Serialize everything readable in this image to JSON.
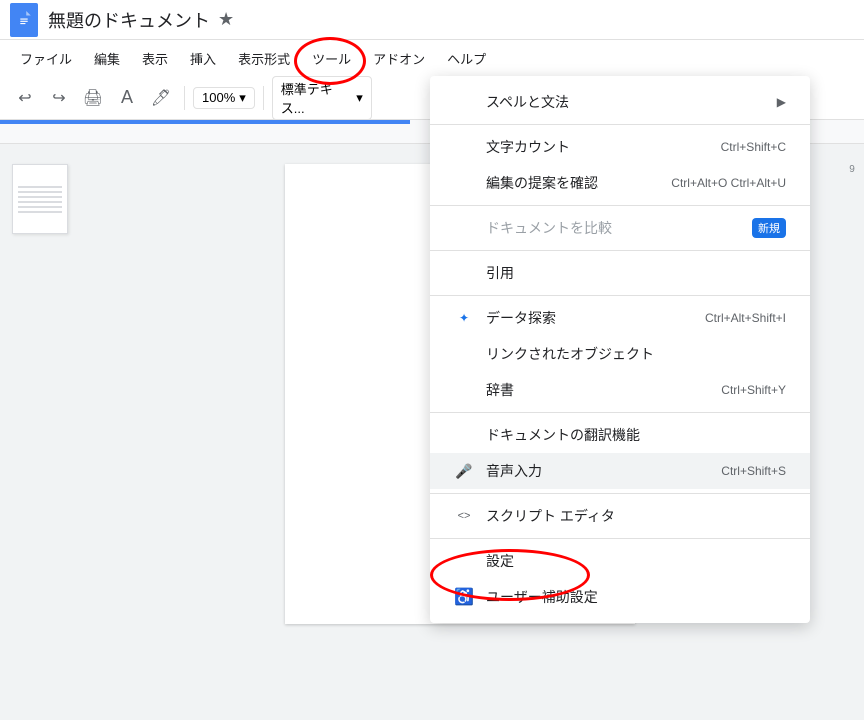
{
  "titleBar": {
    "docTitle": "無題のドキュメント",
    "starLabel": "★"
  },
  "menuBar": {
    "items": [
      {
        "id": "file",
        "label": "ファイル"
      },
      {
        "id": "edit",
        "label": "編集"
      },
      {
        "id": "view",
        "label": "表示"
      },
      {
        "id": "insert",
        "label": "挿入"
      },
      {
        "id": "format",
        "label": "表示形式"
      },
      {
        "id": "tools",
        "label": "ツール"
      },
      {
        "id": "addons",
        "label": "アドオン"
      },
      {
        "id": "help",
        "label": "ヘルプ"
      }
    ]
  },
  "toolbar": {
    "zoom": "100%",
    "style": "標準テキス..."
  },
  "dropdownMenu": {
    "items": [
      {
        "id": "spell",
        "label": "スペルと文法",
        "icon": "",
        "shortcut": "",
        "hasArrow": true,
        "disabled": false,
        "highlighted": false
      },
      {
        "id": "wordcount",
        "label": "文字カウント",
        "icon": "",
        "shortcut": "Ctrl+Shift+C",
        "hasArrow": false,
        "disabled": false,
        "highlighted": false
      },
      {
        "id": "editsuggestions",
        "label": "編集の提案を確認",
        "icon": "",
        "shortcut": "Ctrl+Alt+O Ctrl+Alt+U",
        "hasArrow": false,
        "disabled": false,
        "highlighted": false
      },
      {
        "id": "compare",
        "label": "ドキュメントを比較",
        "icon": "",
        "shortcut": "",
        "badge": "新規",
        "hasArrow": false,
        "disabled": true,
        "highlighted": false
      },
      {
        "id": "citation",
        "label": "引用",
        "icon": "",
        "shortcut": "",
        "hasArrow": false,
        "disabled": false,
        "highlighted": false
      },
      {
        "id": "explore",
        "label": "データ探索",
        "icon": "★",
        "shortcut": "Ctrl+Alt+Shift+I",
        "hasArrow": false,
        "disabled": false,
        "highlighted": false
      },
      {
        "id": "linkedobjects",
        "label": "リンクされたオブジェクト",
        "icon": "",
        "shortcut": "",
        "hasArrow": false,
        "disabled": false,
        "highlighted": false
      },
      {
        "id": "dictionary",
        "label": "辞書",
        "icon": "",
        "shortcut": "Ctrl+Shift+Y",
        "hasArrow": false,
        "disabled": false,
        "highlighted": false
      },
      {
        "id": "translate",
        "label": "ドキュメントの翻訳機能",
        "icon": "",
        "shortcut": "",
        "hasArrow": false,
        "disabled": false,
        "highlighted": false
      },
      {
        "id": "voice",
        "label": "音声入力",
        "icon": "🎤",
        "shortcut": "Ctrl+Shift+S",
        "hasArrow": false,
        "disabled": false,
        "highlighted": true
      },
      {
        "id": "scripteditor",
        "label": "スクリプト エディタ",
        "icon": "<>",
        "shortcut": "",
        "hasArrow": false,
        "disabled": false,
        "highlighted": false
      },
      {
        "id": "settings",
        "label": "設定",
        "icon": "",
        "shortcut": "",
        "hasArrow": false,
        "disabled": false,
        "highlighted": false
      },
      {
        "id": "accessibility",
        "label": "ユーザー補助設定",
        "icon": "♿",
        "shortcut": "",
        "hasArrow": false,
        "disabled": false,
        "highlighted": false
      }
    ],
    "separators": [
      1,
      3,
      4,
      5,
      7,
      8,
      9,
      10,
      11
    ]
  },
  "rightNumbers": [
    "9"
  ]
}
